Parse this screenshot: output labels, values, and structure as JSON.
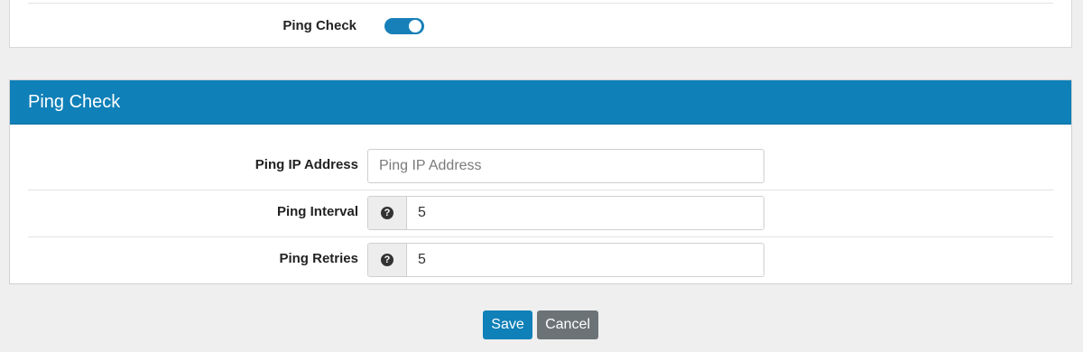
{
  "top": {
    "label": "Ping Check",
    "toggle_state": "on"
  },
  "panel": {
    "title": "Ping Check",
    "rows": [
      {
        "label": "Ping IP Address",
        "value": "",
        "placeholder": "Ping IP Address",
        "help_icon": "question-circle-icon"
      },
      {
        "label": "Ping Interval",
        "value": "5",
        "help_icon": "question-circle-icon"
      },
      {
        "label": "Ping Retries",
        "value": "5",
        "help_icon": "question-circle-icon"
      }
    ]
  },
  "actions": {
    "save_label": "Save",
    "cancel_label": "Cancel"
  },
  "colors": {
    "accent": "#0f80b8",
    "cancel": "#6c7377",
    "background": "#efefef"
  }
}
